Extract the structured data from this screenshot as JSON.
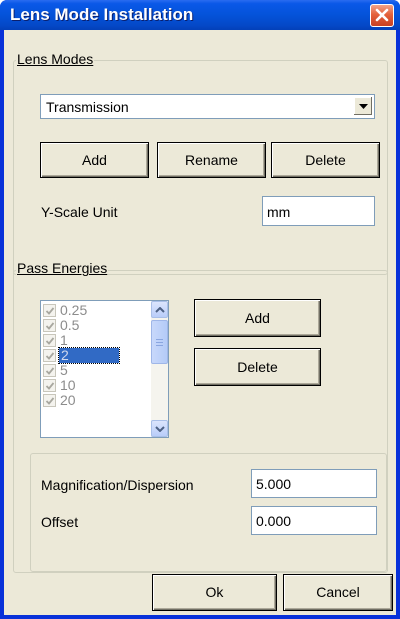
{
  "window": {
    "title": "Lens Mode Installation",
    "colors": {
      "titlebar": "#0453d9",
      "close": "#e4623b",
      "face": "#ece9d8"
    }
  },
  "lens_modes": {
    "group_label": "Lens Modes",
    "selected_mode": "Transmission",
    "add_label": "Add",
    "rename_label": "Rename",
    "delete_label": "Delete",
    "yscale_label": "Y-Scale Unit",
    "yscale_value": "mm"
  },
  "pass_energies": {
    "group_label": "Pass Energies",
    "items": [
      {
        "label": "0.25",
        "checked": true
      },
      {
        "label": "0.5",
        "checked": true
      },
      {
        "label": "1",
        "checked": true
      },
      {
        "label": "2",
        "checked": true,
        "selected": true
      },
      {
        "label": "5",
        "checked": true
      },
      {
        "label": "10",
        "checked": true
      },
      {
        "label": "20",
        "checked": true
      }
    ],
    "add_label": "Add",
    "delete_label": "Delete"
  },
  "parameters": {
    "magnification_label": "Magnification/Dispersion",
    "magnification_value": "5.000",
    "offset_label": "Offset",
    "offset_value": "0.000"
  },
  "footer": {
    "ok_label": "Ok",
    "cancel_label": "Cancel"
  },
  "icons": [
    "close-icon",
    "dropdown-arrow-icon",
    "checkbox-icon",
    "scroll-up-icon",
    "scroll-down-icon"
  ]
}
